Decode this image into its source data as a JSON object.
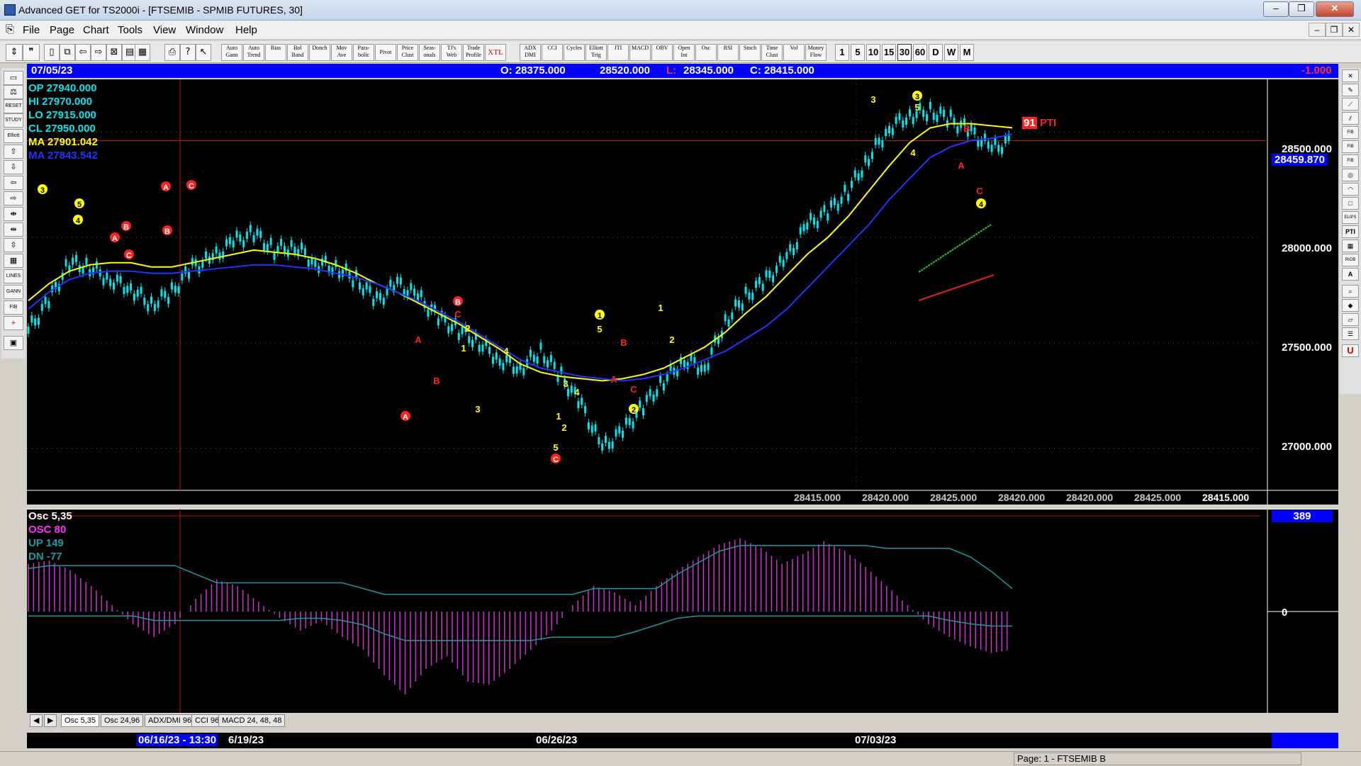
{
  "window": {
    "title": "Advanced GET for TS2000i - [FTSEMIB - SPMIB FUTURES, 30]",
    "min": "‒",
    "max": "❐",
    "close": "✕"
  },
  "menu": [
    "File",
    "Page",
    "Chart",
    "Tools",
    "View",
    "Window",
    "Help"
  ],
  "toolbar": {
    "study_buttons": [
      "Auto Gann",
      "Auto Trend",
      "Bias",
      "Bol Band",
      "Donch",
      "Mov Ave",
      "Para-bolic",
      "Pivot",
      "Price Clust",
      "Seas-onals",
      "TJ's Web",
      "Trade Profile",
      "XTL",
      "ADX DMI",
      "CCI",
      "Cycles",
      "Elliott Trig",
      "JTI",
      "MACD",
      "OBV",
      "Open Int",
      "Osc",
      "RSI",
      "Stoch",
      "Time Clust",
      "Vol",
      "Money Flow"
    ],
    "periods": [
      "1",
      "5",
      "10",
      "15",
      "30",
      "60",
      "D",
      "W",
      "M"
    ],
    "selected_period": "30"
  },
  "left_tools": [
    "RESET",
    "STUDY",
    "Elliott",
    "LINES",
    "GANN",
    "FIB"
  ],
  "right_tools": [
    "FIB RET",
    "FIB EXT",
    "FIB TIME",
    "ELIPS",
    "PTI",
    "RIOB"
  ],
  "info": {
    "date": "07/05/23",
    "open": "O: 28375.000",
    "high": "28520.000",
    "low_label": "L:",
    "low": "28345.000",
    "close": "C: 28415.000",
    "change": "-1.000"
  },
  "chart_readout": {
    "op": "OP  27940.000",
    "hi": "HI   27970.000",
    "lo": "LO  27915.000",
    "cl": "CL  27950.000",
    "ma1": "MA  27901.042",
    "ma2": "MA  27843.542"
  },
  "axis": {
    "price_labels": [
      "28500.000",
      "28000.000",
      "27500.000",
      "27000.000"
    ],
    "current_price": "28459.870"
  },
  "pti": {
    "value": "91",
    "label": "PTI"
  },
  "close_strip": [
    "28415.000",
    "28420.000",
    "28425.000",
    "28420.000",
    "28420.000",
    "28425.000",
    "28415.000"
  ],
  "osc_readout": {
    "title": "Osc 5,35",
    "osc": "OSC 80",
    "up": "UP   149",
    "dn": "DN   -77",
    "value": "389",
    "zero": "0"
  },
  "osc_tabs": [
    "Osc 5,35",
    "Osc 24,96",
    "ADX/DMI 96",
    "CCI 96",
    "MACD 24, 48, 48"
  ],
  "dates": {
    "cursor": "06/16/23 - 13:30",
    "d1": "6/19/23",
    "d2": "06/26/23",
    "d3": "07/03/23"
  },
  "status": "Page: 1 - FTSEMIB B",
  "colors": {
    "info_bar": "#0000ff",
    "candle": "#00e5ee",
    "ma_fast": "#ffff00",
    "ma_slow": "#2233ff",
    "elliott_red": "#ff2020",
    "elliott_yellow": "#ffff00",
    "osc": "#cc33cc"
  },
  "chart_data": {
    "type": "line",
    "title": "FTSEMIB - SPMIB FUTURES, 30",
    "xlabel": "",
    "ylabel": "",
    "ylim": [
      26800,
      28750
    ],
    "x_ticks": [
      "06/16/23",
      "06/19/23",
      "06/26/23",
      "07/03/23"
    ],
    "series": [
      {
        "values": [
          27560,
          27700,
          27880,
          27860,
          27800,
          27760,
          27680,
          27740,
          27860,
          27900,
          27980,
          28020,
          27940,
          27960,
          27880,
          27860,
          27800,
          27700,
          27780,
          27720,
          27620,
          27560,
          27500,
          27420,
          27380,
          27460,
          27340,
          27200,
          27000,
          27080,
          27200,
          27320,
          27420,
          27380,
          27600,
          27720,
          27800,
          27900,
          28060,
          28120,
          28220,
          28380,
          28520,
          28580,
          28600,
          28560,
          28500,
          28420,
          28459
        ]
      },
      {
        "name": "MA 27901.042",
        "values": [
          27700,
          27780,
          27840,
          27870,
          27880,
          27880,
          27860,
          27860,
          27880,
          27900,
          27920,
          27940,
          27930,
          27920,
          27900,
          27870,
          27830,
          27780,
          27740,
          27690,
          27640,
          27590,
          27530,
          27470,
          27400,
          27360,
          27340,
          27330,
          27320,
          27330,
          27350,
          27380,
          27430,
          27480,
          27550,
          27640,
          27720,
          27820,
          27920,
          28000,
          28100,
          28220,
          28340,
          28450,
          28520,
          28540,
          28540,
          28530,
          28520
        ]
      },
      {
        "name": "MA 27843.542",
        "values": [
          27660,
          27740,
          27800,
          27830,
          27840,
          27840,
          27830,
          27830,
          27840,
          27850,
          27860,
          27870,
          27870,
          27860,
          27850,
          27830,
          27810,
          27780,
          27740,
          27700,
          27650,
          27600,
          27540,
          27480,
          27420,
          27380,
          27360,
          27340,
          27330,
          27320,
          27330,
          27350,
          27380,
          27420,
          27460,
          27520,
          27580,
          27660,
          27760,
          27860,
          27960,
          28060,
          28180,
          28280,
          28380,
          28430,
          28460,
          28470,
          28490
        ]
      },
      {
        "name": "OSC 80",
        "values": [
          150,
          160,
          130,
          80,
          20,
          -40,
          -80,
          -40,
          40,
          100,
          80,
          30,
          -20,
          -60,
          -30,
          -80,
          -120,
          -200,
          -260,
          -180,
          -140,
          -220,
          -230,
          -180,
          -120,
          -60,
          20,
          80,
          60,
          20,
          80,
          130,
          170,
          210,
          230,
          200,
          150,
          180,
          220,
          190,
          140,
          80,
          20,
          -40,
          -80,
          -110,
          -130,
          -120
        ]
      }
    ]
  }
}
